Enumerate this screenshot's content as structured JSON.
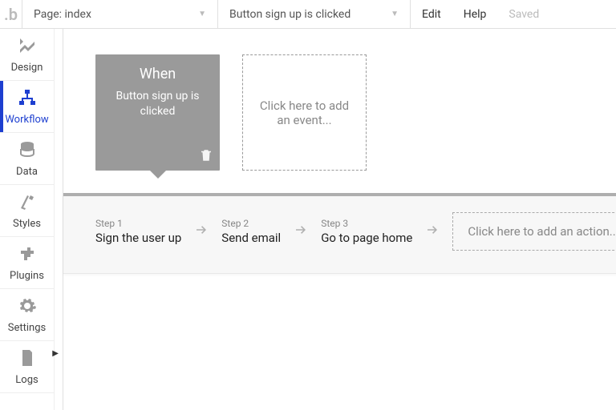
{
  "topbar": {
    "page_dd": "Page: index",
    "event_dd": "Button sign up is clicked",
    "edit": "Edit",
    "help": "Help",
    "saved": "Saved"
  },
  "sidebar": {
    "items": [
      {
        "label": "Design"
      },
      {
        "label": "Workflow"
      },
      {
        "label": "Data"
      },
      {
        "label": "Styles"
      },
      {
        "label": "Plugins"
      },
      {
        "label": "Settings"
      },
      {
        "label": "Logs"
      }
    ]
  },
  "event_card": {
    "title": "When",
    "desc": "Button sign up is clicked"
  },
  "add_event": "Click here to add an event...",
  "steps": [
    {
      "label": "Step 1",
      "text": "Sign the user up"
    },
    {
      "label": "Step 2",
      "text": "Send email"
    },
    {
      "label": "Step 3",
      "text": "Go to page home"
    }
  ],
  "add_action": "Click here to add an action..."
}
